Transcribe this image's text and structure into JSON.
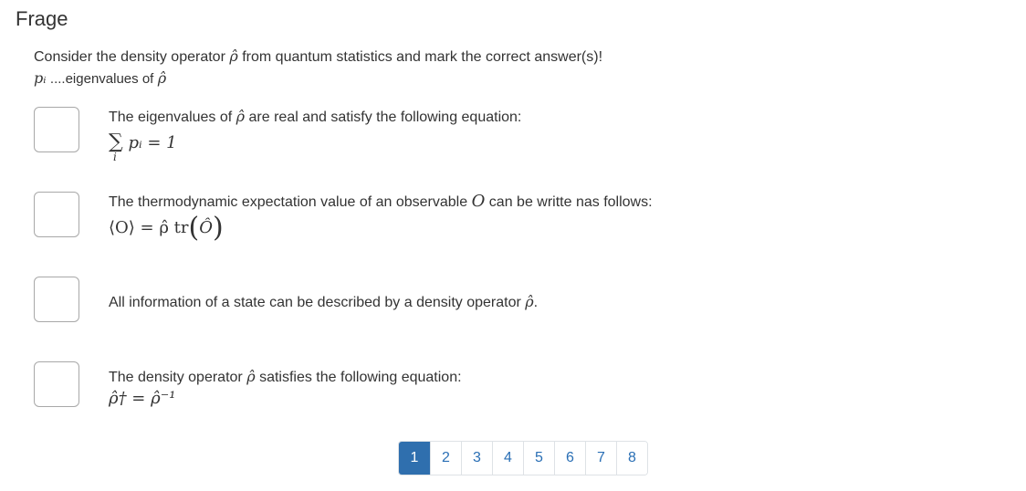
{
  "title": "Frage",
  "intro": {
    "line1_prefix": "Consider the density operator",
    "rho": "ρ̂",
    "line1_suffix": "from quantum statistics and mark the correct answer(s)!",
    "line2_symbol": "pᵢ",
    "line2_text": "....eigenvalues of"
  },
  "options": [
    {
      "text_before": "The eigenvalues of",
      "symbol": "ρ̂",
      "text_after": "are real and satisfy the following equation:",
      "formula": "pᵢ = 1",
      "sum_symbol": "∑",
      "sum_index": "i"
    },
    {
      "text_before": "The thermodynamic expectation value of an observable",
      "symbol": "O",
      "text_after": "can be writte nas follows:",
      "formula_left": "⟨O⟩ = ρ̂ tr",
      "formula_inner": "Ô"
    },
    {
      "text_before": "All information of a state can be described by a density operator",
      "symbol": "ρ̂",
      "text_after": "."
    },
    {
      "text_before": "The density operator",
      "symbol": "ρ̂",
      "text_after": "satisfies the following equation:",
      "formula": "ρ̂† = ρ̂⁻¹"
    }
  ],
  "pagination": {
    "pages": [
      "1",
      "2",
      "3",
      "4",
      "5",
      "6",
      "7",
      "8"
    ],
    "active": "1"
  }
}
